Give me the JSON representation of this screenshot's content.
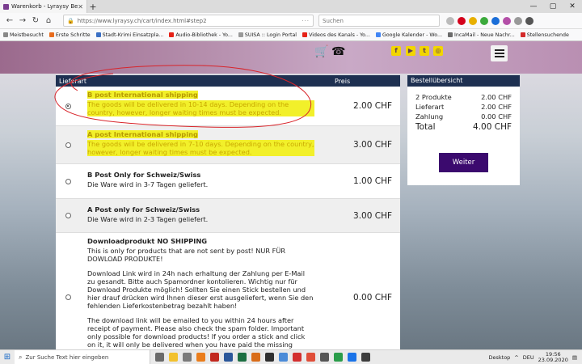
{
  "browser": {
    "tab_title": "Warenkorb - Lyraysy Bewegun...",
    "url": "https://www.lyraysy.ch/cart/index.html#step2",
    "search_placeholder": "Suchen"
  },
  "bookmarks": [
    {
      "label": "Meistbesucht",
      "color": "#888888"
    },
    {
      "label": "Erste Schritte",
      "color": "#e86b1d"
    },
    {
      "label": "Stadt-Krimi Einsatzpla...",
      "color": "#3a6fc4"
    },
    {
      "label": "Audio-Bibliothek - Yo...",
      "color": "#e62117"
    },
    {
      "label": "SUISA :: Login Portal",
      "color": "#999999"
    },
    {
      "label": "Videos des Kanals - Yo...",
      "color": "#e62117"
    },
    {
      "label": "Google Kalender - Wo...",
      "color": "#4285f4"
    },
    {
      "label": "IncaMail - Neue Nachr...",
      "color": "#6b6b6b"
    },
    {
      "label": "Stellensuchende",
      "color": "#d42a2a"
    }
  ],
  "table": {
    "col_delivery": "Lieferart",
    "col_price": "Preis",
    "options": [
      {
        "title": "B post International shipping",
        "lines": [
          "The goods will be delivered in 10-14 days. Depending on the country, however, longer waiting times must be expected."
        ],
        "price": "2.00 CHF",
        "selected": true,
        "highlight": true
      },
      {
        "title": "A post International shipping",
        "lines": [
          "The goods will be delivered in 7-10 days. Depending on the country, however, longer waiting times must be expected."
        ],
        "price": "3.00 CHF",
        "selected": false,
        "highlight": true
      },
      {
        "title": "B Post Only for Schweiz/Swiss",
        "lines": [
          "Die Ware wird in 3-7 Tagen geliefert."
        ],
        "price": "1.00 CHF",
        "selected": false,
        "highlight": false
      },
      {
        "title": "A Post only for Schweiz/Swiss",
        "lines": [
          "Die Ware wird in 2-3 Tagen geliefert."
        ],
        "price": "3.00 CHF",
        "selected": false,
        "highlight": false
      },
      {
        "title": "Downloadprodukt NO SHIPPING",
        "lines": [
          "This is only for products that are not sent by post! NUR FÜR DOWLOAD PRODUKTE!",
          "Download Link wird in 24h nach erhaltung der Zahlung per E-Mail zu gesandt. Bitte auch Spamordner kontolieren. Wichtig nur für Download Produkte möglich! Sollten Sie einen Stick bestellen und hier drauf drücken wird Ihnen dieser erst ausgeliefert, wenn Sie den fehlenden Lieferkostenbetrag bezahlt haben!",
          "The download link will be emailed to you within 24 hours after receipt of payment. Please also check the spam folder. Important only possible for download products! If you order a stick and click on it, it will only be delivered when you have paid the missing delivery"
        ],
        "price": "0.00 CHF",
        "selected": false,
        "highlight": false
      }
    ]
  },
  "summary": {
    "title": "Bestellübersicht",
    "rows": [
      {
        "label": "2 Produkte",
        "value": "2.00 CHF"
      },
      {
        "label": "Lieferart",
        "value": "2.00 CHF"
      },
      {
        "label": "Zahlung",
        "value": "0.00 CHF"
      }
    ],
    "total_label": "Total",
    "total_value": "4.00 CHF",
    "button": "Weiter"
  },
  "taskbar": {
    "search_placeholder": "Zur Suche Text hier eingeben",
    "desktop_label": "Desktop",
    "language": "DEU",
    "time": "19:56",
    "date": "23.09.2020"
  }
}
